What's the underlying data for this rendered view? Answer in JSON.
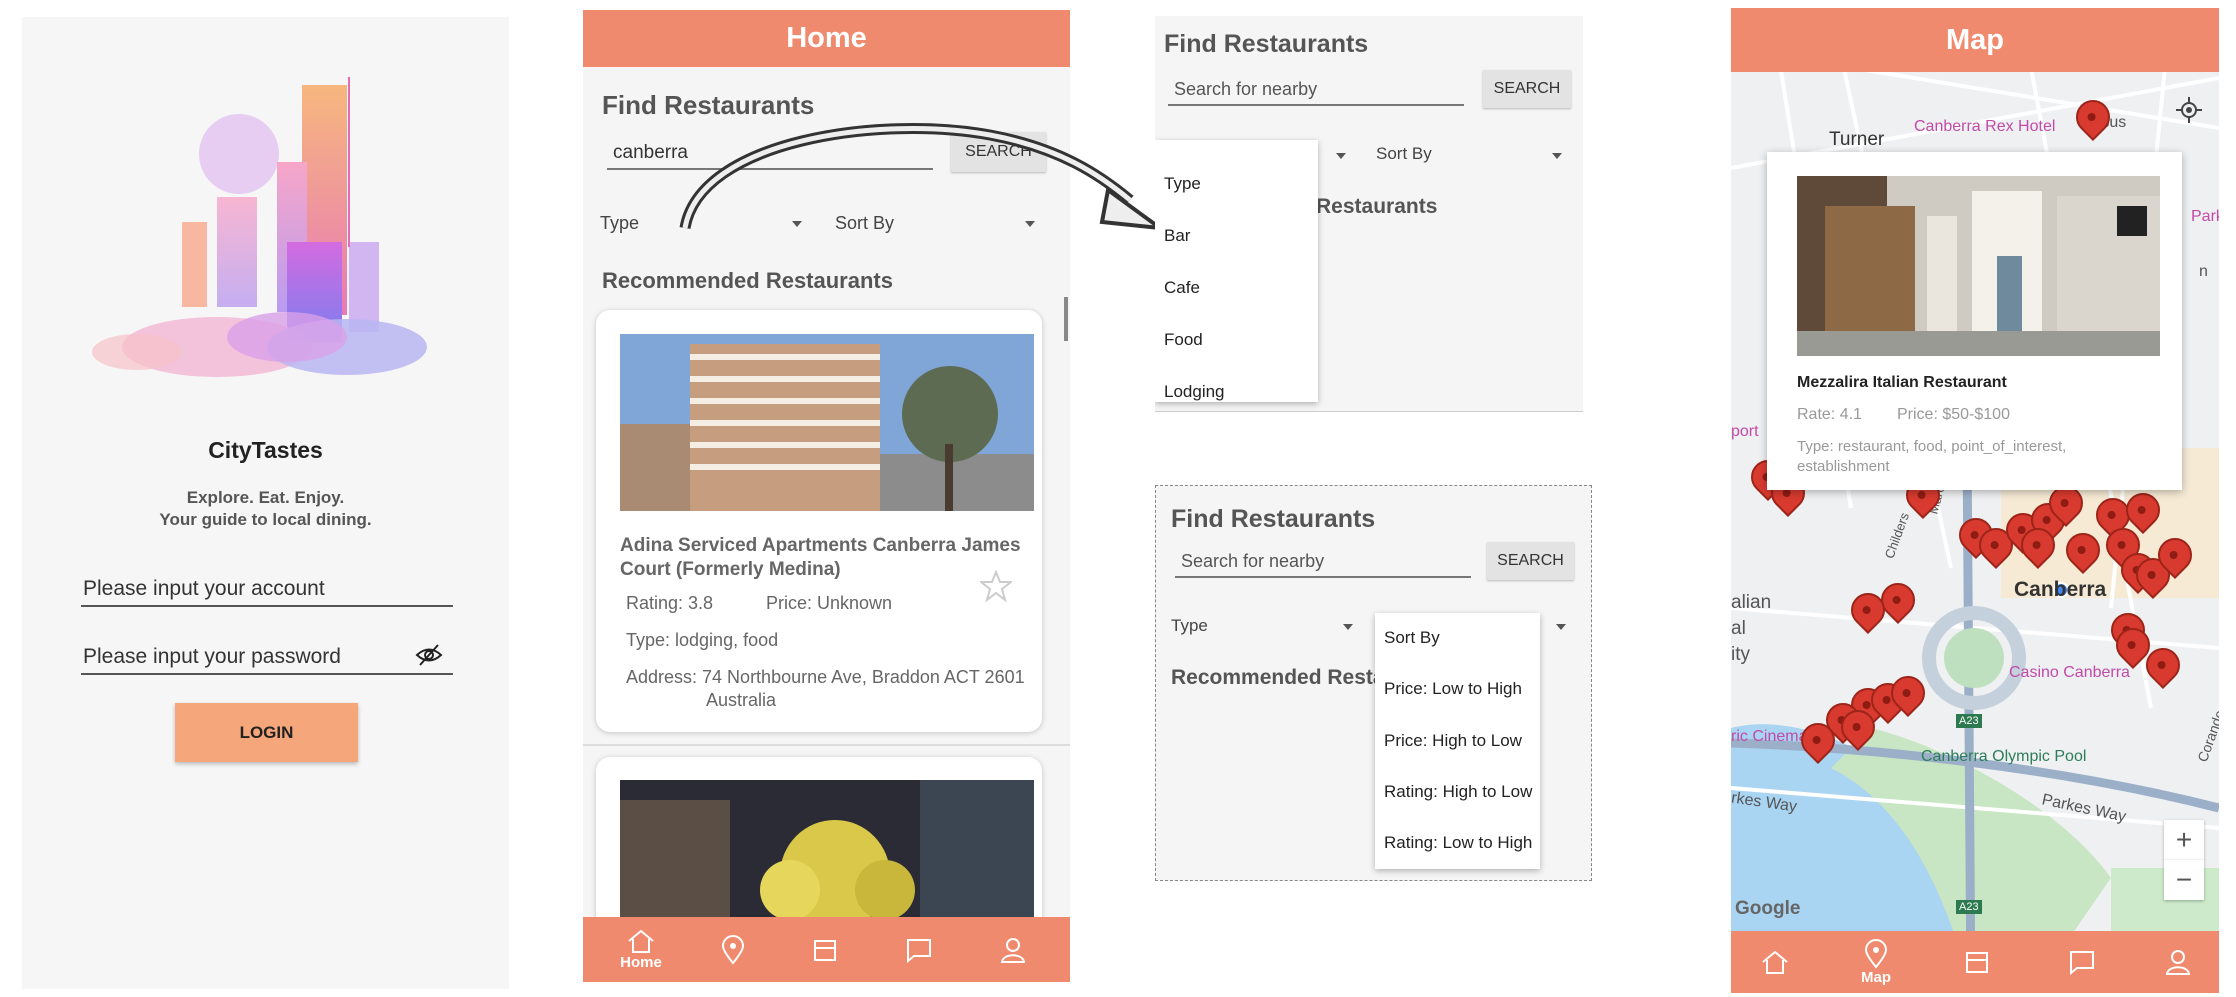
{
  "login": {
    "app_name": "CityTastes",
    "tagline_1": "Explore. Eat. Enjoy.",
    "tagline_2": "Your guide to local dining.",
    "account_placeholder": "Please input your account",
    "password_placeholder": "Please input your password",
    "login_label": "LOGIN",
    "eye_icon": "eye-off-icon"
  },
  "home": {
    "title": "Home",
    "find_title": "Find Restaurants",
    "search_value": "canberra",
    "search_label": "SEARCH",
    "type_label": "Type",
    "sort_label": "Sort By",
    "recommended_title": "Recommended Restaurants",
    "card1": {
      "name_line1": "Adina Serviced Apartments Canberra James",
      "name_line2": "Court (Formerly Medina)",
      "rating": "Rating: 3.8",
      "price": "Price: Unknown",
      "type": "Type:  lodging, food",
      "address_line1": "Address: 74 Northbourne Ave, Braddon ACT 2601",
      "address_line2": "Australia"
    },
    "nav": {
      "home_label": "Home",
      "icons": [
        "home-icon",
        "map-pin-icon",
        "store-icon",
        "chat-icon",
        "person-icon"
      ]
    }
  },
  "dropdown_type": {
    "find_title": "Find Restaurants",
    "search_placeholder": "Search for nearby",
    "search_label": "SEARCH",
    "sort_label": "Sort By",
    "options": [
      "Type",
      "Bar",
      "Cafe",
      "Food",
      "Lodging"
    ],
    "restaurants_partial": "Restaurants"
  },
  "dropdown_sort": {
    "find_title": "Find Restaurants",
    "search_placeholder": "Search for nearby",
    "search_label": "SEARCH",
    "type_label": "Type",
    "recommended_partial": "Recommended Resta",
    "options": [
      "Sort By",
      "Price: Low to High",
      "Price: High to Low",
      "Rating: High to Low",
      "Rating: Low to High"
    ]
  },
  "map": {
    "title": "Map",
    "labels": {
      "turner": "Turner",
      "rex_hotel": "Canberra Rex Hotel",
      "canberra": "Canberra",
      "casino": "Casino Canberra",
      "olympic_pool": "Canberra Olympic Pool",
      "parkes_way": "Parkes Way",
      "parkes_way_left": "rkes Way",
      "cinemas": "ric Cinemas",
      "a23": "A23",
      "google": "Google",
      "alian": "alian",
      "al": "al",
      "ity": "ity",
      "port": "port",
      "ipsus": "Ipsus",
      "park": "Park",
      "n": "n",
      "corande": "Corande",
      "childers": "Childers",
      "marcus": "Marcus Cl"
    },
    "popup": {
      "name": "Mezzalira Italian Restaurant",
      "rate": "Rate: 4.1",
      "price": "Price: $50-$100",
      "type_line1": "Type: restaurant, food, point_of_interest,",
      "type_line2": "establishment"
    },
    "zoom_in": "+",
    "zoom_out": "−",
    "nav": {
      "map_label": "Map",
      "icons": [
        "home-icon",
        "map-pin-icon",
        "store-icon",
        "chat-icon",
        "person-icon"
      ]
    }
  },
  "colors": {
    "brand": "#f08a6e",
    "login_button": "#f5a67a",
    "pin": "#d93a2f"
  }
}
